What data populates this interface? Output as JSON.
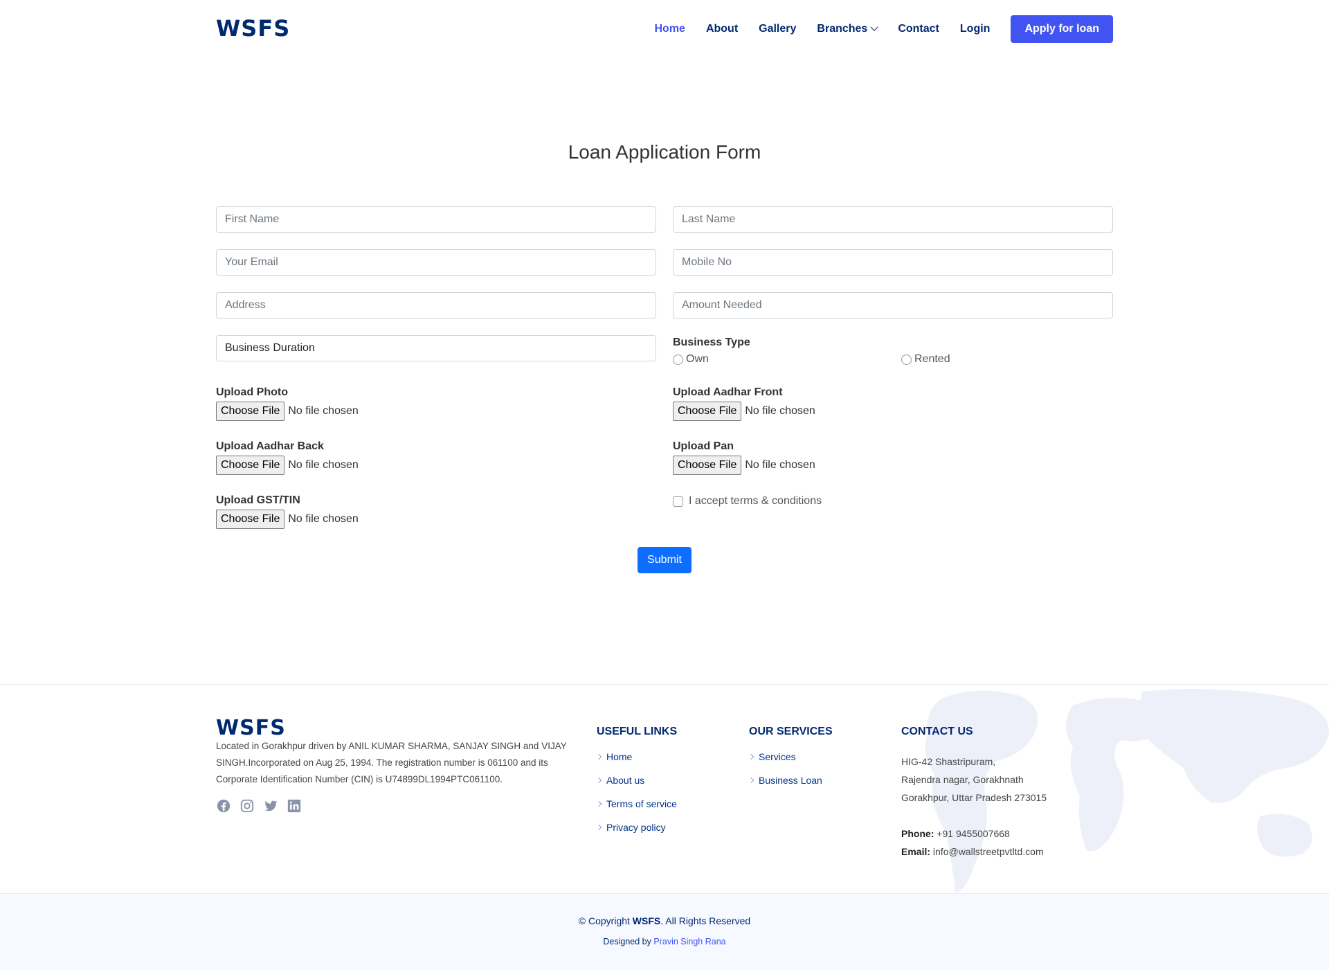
{
  "header": {
    "logo": "WSFS",
    "nav": [
      {
        "label": "Home",
        "active": true
      },
      {
        "label": "About"
      },
      {
        "label": "Gallery"
      },
      {
        "label": "Branches",
        "dropdown": true
      },
      {
        "label": "Contact"
      },
      {
        "label": "Login"
      }
    ],
    "apply_label": "Apply for loan"
  },
  "form": {
    "title": "Loan Application Form",
    "first_name_placeholder": "First Name",
    "last_name_placeholder": "Last Name",
    "email_placeholder": "Your Email",
    "mobile_placeholder": "Mobile No",
    "address_placeholder": "Address",
    "amount_placeholder": "Amount Needed",
    "business_duration_value": "Business Duration",
    "business_type_label": "Business Type",
    "business_type_options": [
      "Own",
      "Rented"
    ],
    "upload_photo_label": "Upload Photo",
    "upload_aadhar_front_label": "Upload Aadhar Front",
    "upload_aadhar_back_label": "Upload Aadhar Back",
    "upload_pan_label": "Upload Pan",
    "upload_gst_label": "Upload GST/TIN",
    "choose_file": "Choose File",
    "no_file": "No file chosen",
    "terms_label": "I accept terms & conditions",
    "submit_label": "Submit"
  },
  "footer": {
    "logo": "WSFS",
    "about": "Located in Gorakhpur driven by ANIL KUMAR SHARMA, SANJAY SINGH and VIJAY SINGH.Incorporated on Aug 25, 1994. The registration number is 061100 and its Corporate Identification Number (CIN) is U74899DL1994PTC061100.",
    "socials": [
      "facebook-icon",
      "instagram-icon",
      "twitter-icon",
      "linkedin-icon"
    ],
    "useful_links_title": "USEFUL LINKS",
    "useful_links": [
      "Home",
      "About us",
      "Terms of service",
      "Privacy policy"
    ],
    "services_title": "OUR SERVICES",
    "services": [
      "Services",
      "Business Loan"
    ],
    "contact_title": "CONTACT US",
    "address_lines": [
      "HIG-42 Shastripuram,",
      "Rajendra nagar, Gorakhnath",
      "Gorakhpur, Uttar Pradesh 273015"
    ],
    "phone_label": "Phone:",
    "phone": "+91 9455007668",
    "email_label": "Email:",
    "email": "info@wallstreetpvtltd.com",
    "copyright_prefix": "© Copyright",
    "copyright_brand": "WSFS",
    "copyright_suffix": ". All Rights Reserved",
    "designed_by": "Designed by",
    "designer": "Pravin Singh Rana"
  }
}
